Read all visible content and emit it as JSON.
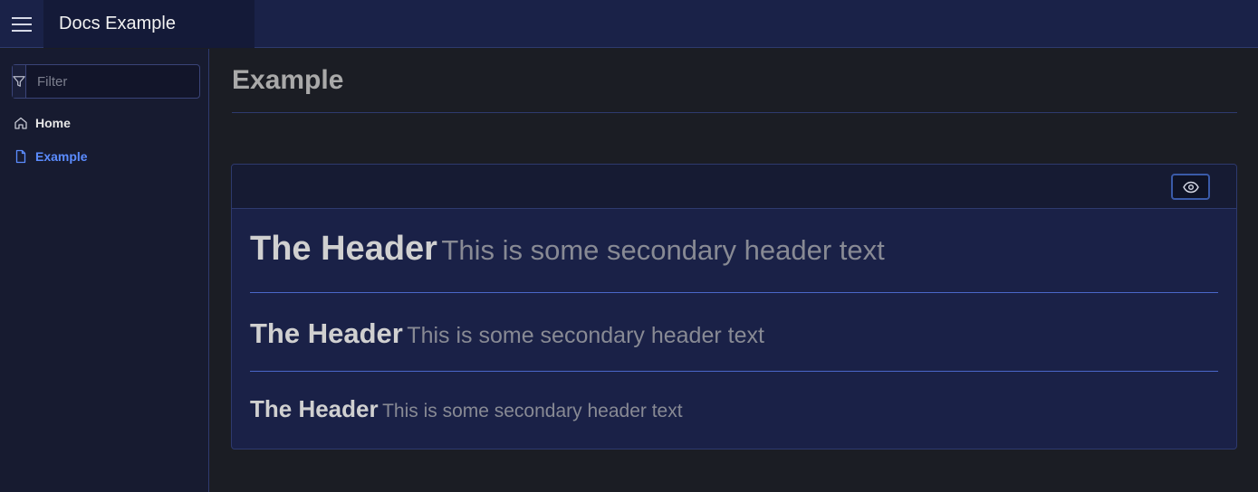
{
  "header": {
    "menu_icon": "hamburger-menu-icon",
    "brand": "Docs Example"
  },
  "sidebar": {
    "filter": {
      "placeholder": "Filter",
      "value": "",
      "icon": "filter-icon"
    },
    "items": [
      {
        "label": "Home",
        "icon": "home-icon",
        "active": false
      },
      {
        "label": "Example",
        "icon": "file-icon",
        "active": true
      }
    ]
  },
  "main": {
    "title": "Example",
    "card": {
      "toolbar_icon": "eye-icon",
      "headers": [
        {
          "main": "The Header",
          "secondary": "This is some secondary header text"
        },
        {
          "main": "The Header",
          "secondary": "This is some secondary header text"
        },
        {
          "main": "The Header",
          "secondary": "This is some secondary header text"
        }
      ]
    }
  },
  "colors": {
    "topbar": "#1a2248",
    "accent": "#5b8cff",
    "divider": "#4a67c9"
  }
}
